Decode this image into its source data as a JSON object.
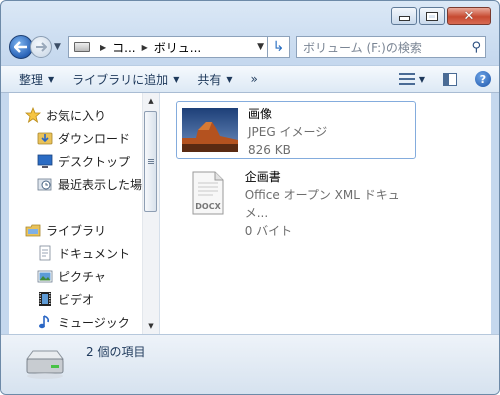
{
  "address": {
    "segments": [
      "コ...",
      "ボリュ..."
    ]
  },
  "search": {
    "placeholder": "ボリューム (F:)の検索"
  },
  "toolbar": {
    "organize": "整理",
    "add_to_library": "ライブラリに追加",
    "share": "共有",
    "more": "»"
  },
  "nav": {
    "favorites": {
      "label": "お気に入り",
      "items": [
        "ダウンロード",
        "デスクトップ",
        "最近表示した場所"
      ]
    },
    "libraries": {
      "label": "ライブラリ",
      "items": [
        "ドキュメント",
        "ピクチャ",
        "ビデオ",
        "ミュージック"
      ]
    }
  },
  "files": [
    {
      "name": "画像",
      "type": "JPEG イメージ",
      "size": "826 KB",
      "icon": "jpeg-thumbnail"
    },
    {
      "name": "企画書",
      "type": "Office オープン XML ドキュメ...",
      "size": "0 バイト",
      "icon": "docx-icon",
      "badge": "DOCX"
    }
  ],
  "status": {
    "count_text": "2 個の項目"
  },
  "colors": {
    "selection_border": "#84acdd",
    "window_frame": "#6d8aa8"
  }
}
